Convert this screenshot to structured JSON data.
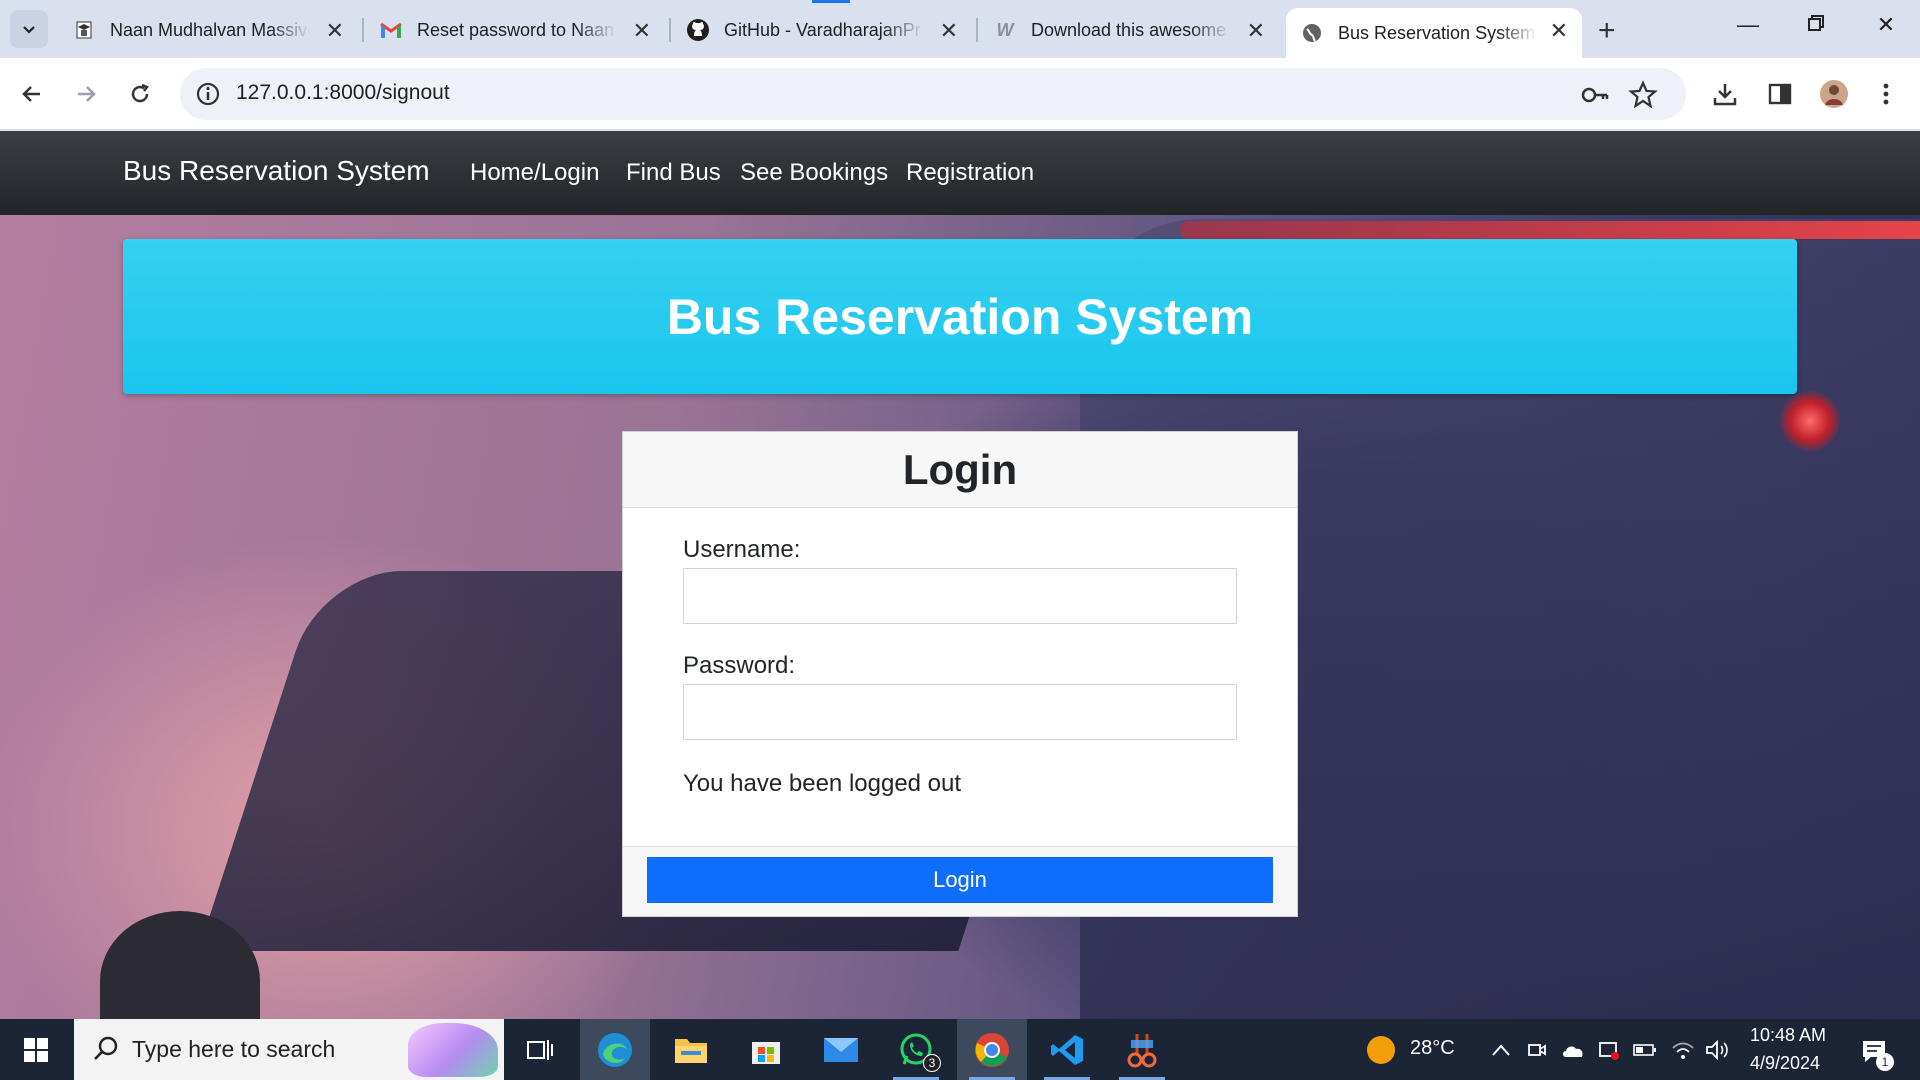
{
  "browser": {
    "tabs": [
      {
        "title": "Naan Mudhalvan Massive",
        "icon": "graduate-icon"
      },
      {
        "title": "Reset password to Naan",
        "icon": "gmail-icon"
      },
      {
        "title": "GitHub - VaradharajanPr",
        "icon": "github-icon"
      },
      {
        "title": "Download this awesome",
        "icon": "w-icon"
      },
      {
        "title": "Bus Reservation System in",
        "icon": "globe-icon",
        "active": true
      }
    ],
    "url": "127.0.0.1:8000/signout"
  },
  "site": {
    "brand": "Bus Reservation System",
    "nav": [
      "Home/Login",
      "Find Bus",
      "See Bookings",
      "Registration"
    ],
    "hero_title": "Bus Reservation System"
  },
  "login": {
    "title": "Login",
    "username_label": "Username:",
    "username_value": "",
    "password_label": "Password:",
    "password_value": "",
    "message": "You have been logged out",
    "submit_label": "Login"
  },
  "taskbar": {
    "search_placeholder": "Type here to search",
    "whatsapp_badge": "3",
    "weather": "28°C",
    "time": "10:48 AM",
    "date": "4/9/2024",
    "notifications_badge": "1"
  },
  "colors": {
    "navbar": "#212529",
    "hero": "#1ec8ef",
    "primary_button": "#0d6efd"
  }
}
